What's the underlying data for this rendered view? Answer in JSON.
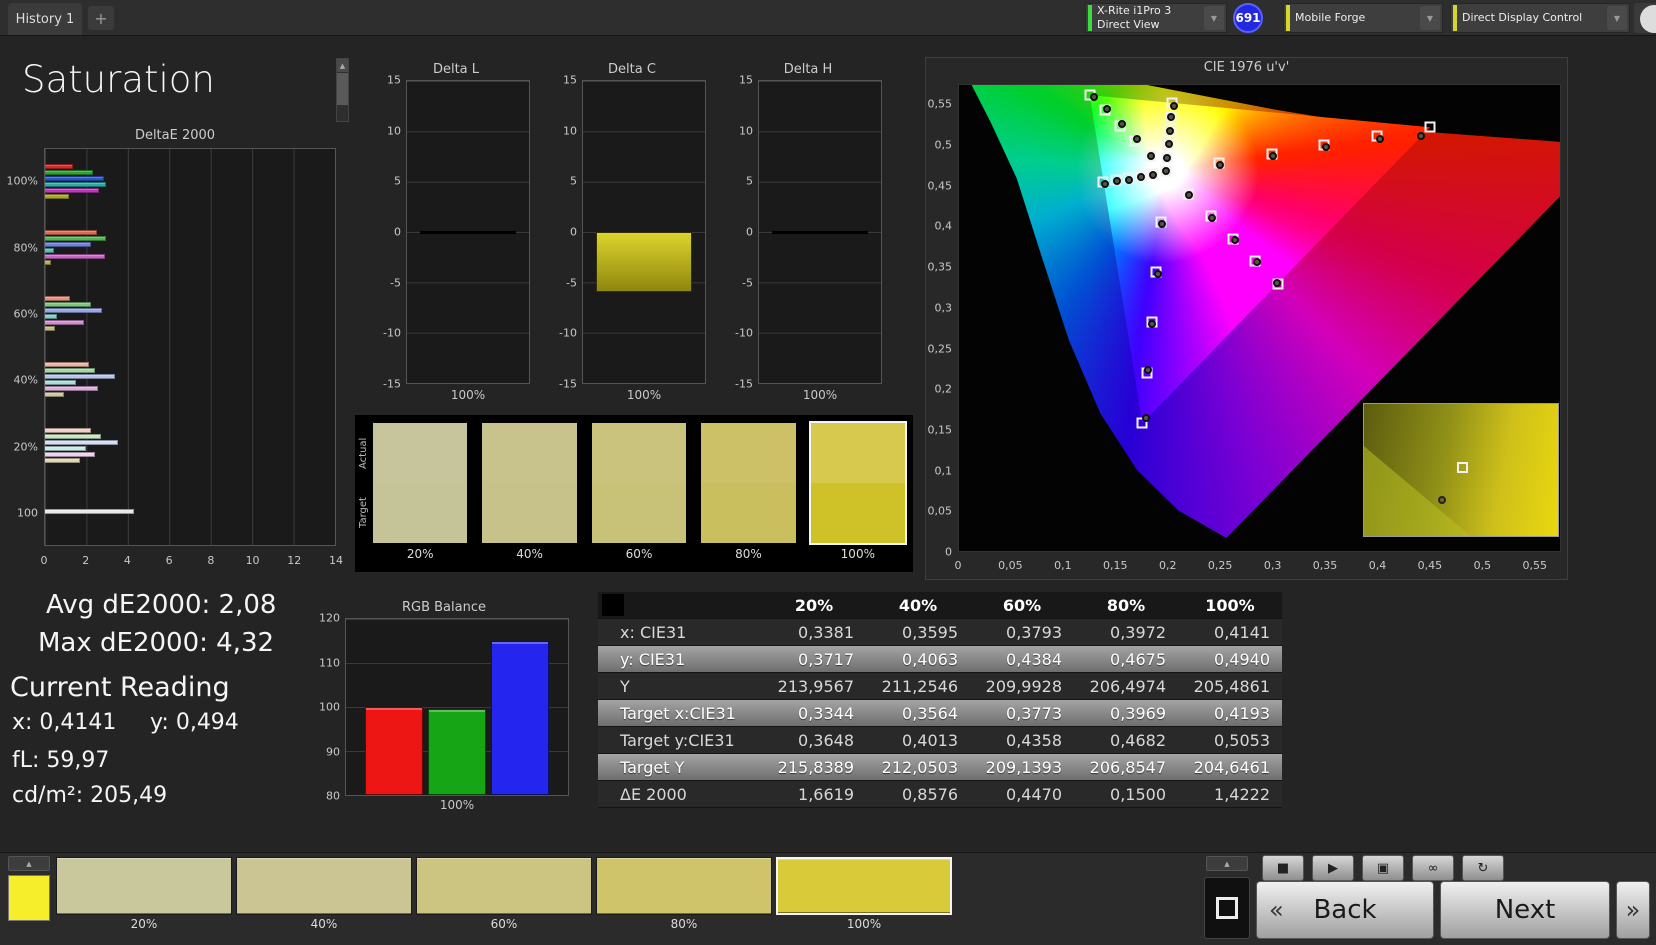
{
  "topbar": {
    "tab": "History 1",
    "add_tab": "+",
    "meter": {
      "line1": "X-Rite i1Pro 3",
      "line2": "Direct View",
      "accent": "#3ddc3d"
    },
    "badge": "691",
    "source": "Mobile Forge",
    "source_accent": "#d6d62a",
    "display_control": "Direct Display Control",
    "display_accent": "#d6d62a"
  },
  "page_title": "Saturation",
  "readings": {
    "avg": "Avg dE2000: 2,08",
    "max": "Max dE2000: 4,32",
    "heading": "Current Reading",
    "x": "x: 0,4141",
    "y": "y: 0,494",
    "fl": "fL: 59,97",
    "cd": "cd/m²: 205,49"
  },
  "strip": {
    "rows": [
      "Actual",
      "Target"
    ],
    "swatches": [
      {
        "label": "20%",
        "actual": "#c7c59c",
        "target": "#c5c398",
        "selected": false
      },
      {
        "label": "40%",
        "actual": "#c8c38d",
        "target": "#c6c289",
        "selected": false
      },
      {
        "label": "60%",
        "actual": "#cac37d",
        "target": "#c8c278",
        "selected": false
      },
      {
        "label": "80%",
        "actual": "#ccc167",
        "target": "#cabf5e",
        "selected": false
      },
      {
        "label": "100%",
        "actual": "#d7c94d",
        "target": "#cfc128",
        "selected": true
      }
    ]
  },
  "bottom": {
    "current_color": "#f6ee2b",
    "swatches": [
      {
        "label": "20%",
        "color": "#c9c79c",
        "selected": false
      },
      {
        "label": "40%",
        "color": "#cac592",
        "selected": false
      },
      {
        "label": "60%",
        "color": "#ccc481",
        "selected": false
      },
      {
        "label": "80%",
        "color": "#cfc46a",
        "selected": false
      },
      {
        "label": "100%",
        "color": "#d9ca3a",
        "selected": true
      }
    ],
    "transport": [
      {
        "name": "stop",
        "glyph": "■"
      },
      {
        "name": "play",
        "glyph": "▶"
      },
      {
        "name": "pattern-window",
        "glyph": "▣"
      },
      {
        "name": "loop",
        "glyph": "∞"
      },
      {
        "name": "continuous",
        "glyph": "↻"
      }
    ],
    "back_chevron": "«",
    "back": "Back",
    "next": "Next",
    "next_chevron": "»",
    "up_arrow": "▲"
  },
  "chart_data": {
    "deltae2000": {
      "type": "bar",
      "orientation": "horizontal",
      "title": "DeltaE 2000",
      "xlim": [
        0,
        14
      ],
      "xticks": [
        0,
        2,
        4,
        6,
        8,
        10,
        12,
        14
      ],
      "groups": [
        {
          "label": "100%",
          "bars": [
            {
              "color": "#d42a2a",
              "value": 1.35
            },
            {
              "color": "#2fa32f",
              "value": 2.3
            },
            {
              "color": "#2f55c8",
              "value": 2.85
            },
            {
              "color": "#2aada0",
              "value": 2.95
            },
            {
              "color": "#b93ab9",
              "value": 2.6
            },
            {
              "color": "#a8a62a",
              "value": 1.15
            }
          ]
        },
        {
          "label": "80%",
          "bars": [
            {
              "color": "#d96a58",
              "value": 2.5
            },
            {
              "color": "#57b257",
              "value": 2.95
            },
            {
              "color": "#6f80d6",
              "value": 2.2
            },
            {
              "color": "#58bdb2",
              "value": 0.45
            },
            {
              "color": "#c467c4",
              "value": 2.9
            },
            {
              "color": "#b3ad56",
              "value": 0.3
            }
          ]
        },
        {
          "label": "60%",
          "bars": [
            {
              "color": "#e29180",
              "value": 1.2
            },
            {
              "color": "#7fc47f",
              "value": 2.2
            },
            {
              "color": "#97a6e0",
              "value": 2.75
            },
            {
              "color": "#83ccc4",
              "value": 0.6
            },
            {
              "color": "#d08ed0",
              "value": 1.9
            },
            {
              "color": "#bfb983",
              "value": 0.5
            }
          ]
        },
        {
          "label": "40%",
          "bars": [
            {
              "color": "#eab4a6",
              "value": 2.1
            },
            {
              "color": "#a6d6a6",
              "value": 2.4
            },
            {
              "color": "#b9c4ea",
              "value": 3.4
            },
            {
              "color": "#a9dcd6",
              "value": 1.5
            },
            {
              "color": "#dcaede",
              "value": 2.55
            },
            {
              "color": "#ccc7a0",
              "value": 0.9
            }
          ]
        },
        {
          "label": "20%",
          "bars": [
            {
              "color": "#f2cfc6",
              "value": 2.2
            },
            {
              "color": "#c6e6c6",
              "value": 2.7
            },
            {
              "color": "#d4dbf4",
              "value": 3.5
            },
            {
              "color": "#c9ebe7",
              "value": 2.0
            },
            {
              "color": "#ecd2ec",
              "value": 2.4
            },
            {
              "color": "#dcd8ba",
              "value": 1.7
            }
          ]
        },
        {
          "label": "100",
          "bars": [
            {
              "color": "#e8e8e8",
              "value": 4.32
            }
          ]
        }
      ]
    },
    "delta_l": {
      "type": "bar",
      "title": "Delta L",
      "ylim": [
        -15,
        15
      ],
      "yticks": [
        15,
        10,
        5,
        0,
        -5,
        -10,
        -15
      ],
      "xlabel": "100%",
      "value": 0,
      "bar_top": "#000000",
      "bar_bottom": "#000000"
    },
    "delta_c": {
      "type": "bar",
      "title": "Delta C",
      "ylim": [
        -15,
        15
      ],
      "yticks": [
        15,
        10,
        5,
        0,
        -5,
        -10,
        -15
      ],
      "xlabel": "100%",
      "value": -6,
      "bar_top": "#dcd42c",
      "bar_bottom": "#8f870e"
    },
    "delta_h": {
      "type": "bar",
      "title": "Delta H",
      "ylim": [
        -15,
        15
      ],
      "yticks": [
        15,
        10,
        5,
        0,
        -5,
        -10,
        -15
      ],
      "xlabel": "100%",
      "value": 0,
      "bar_top": "#000000",
      "bar_bottom": "#000000"
    },
    "rgb_balance": {
      "type": "bar",
      "title": "RGB Balance",
      "ylim": [
        80,
        120
      ],
      "yticks": [
        120,
        110,
        100,
        90,
        80
      ],
      "xlabel": "100%",
      "series": [
        {
          "name": "Red",
          "value": 100,
          "color": "#ee1515"
        },
        {
          "name": "Green",
          "value": 99.5,
          "color": "#15a515"
        },
        {
          "name": "Blue",
          "value": 115,
          "color": "#2525f0"
        }
      ]
    },
    "cie": {
      "type": "scatter",
      "title": "CIE 1976 u'v'",
      "xlim": [
        0,
        0.575
      ],
      "ylim": [
        0,
        0.575
      ],
      "xtick_labels": [
        "0",
        "0,05",
        "0,1",
        "0,15",
        "0,2",
        "0,25",
        "0,3",
        "0,35",
        "0,4",
        "0,45",
        "0,5",
        "0,55"
      ],
      "ytick_labels": [
        "0,55",
        "0,5",
        "0,45",
        "0,4",
        "0,35",
        "0,3",
        "0,25",
        "0,2",
        "0,15",
        "0,1",
        "0,05",
        "0"
      ],
      "gamut_triangle": [
        [
          0.4507,
          0.5229
        ],
        [
          0.125,
          0.5625
        ],
        [
          0.1754,
          0.1579
        ]
      ],
      "white_point": [
        0.1978,
        0.4683
      ],
      "targets": [
        [
          0.1978,
          0.4683
        ],
        [
          0.2484,
          0.4792
        ],
        [
          0.299,
          0.4901
        ],
        [
          0.3495,
          0.5011
        ],
        [
          0.4001,
          0.512
        ],
        [
          0.4507,
          0.5229
        ],
        [
          0.1832,
          0.4871
        ],
        [
          0.1687,
          0.506
        ],
        [
          0.1541,
          0.5248
        ],
        [
          0.1396,
          0.5437
        ],
        [
          0.125,
          0.5625
        ],
        [
          0.1933,
          0.4062
        ],
        [
          0.1888,
          0.3441
        ],
        [
          0.1844,
          0.2821
        ],
        [
          0.1799,
          0.22
        ],
        [
          0.1754,
          0.1579
        ],
        [
          0.1858,
          0.4656
        ],
        [
          0.1739,
          0.463
        ],
        [
          0.1619,
          0.4603
        ],
        [
          0.15,
          0.4577
        ],
        [
          0.138,
          0.455
        ],
        [
          0.2192,
          0.4406
        ],
        [
          0.2407,
          0.413
        ],
        [
          0.2621,
          0.3853
        ],
        [
          0.2836,
          0.3577
        ],
        [
          0.305,
          0.33
        ],
        [
          0.199,
          0.4852
        ],
        [
          0.2003,
          0.5022
        ],
        [
          0.2015,
          0.5191
        ],
        [
          0.2028,
          0.5361
        ],
        [
          0.204,
          0.553
        ]
      ],
      "measured": [
        [
          0.1985,
          0.469
        ],
        [
          0.25,
          0.476
        ],
        [
          0.3,
          0.488
        ],
        [
          0.351,
          0.498
        ],
        [
          0.403,
          0.508
        ],
        [
          0.442,
          0.512
        ],
        [
          0.184,
          0.488
        ],
        [
          0.17,
          0.508
        ],
        [
          0.156,
          0.527
        ],
        [
          0.142,
          0.545
        ],
        [
          0.129,
          0.56
        ],
        [
          0.194,
          0.404
        ],
        [
          0.19,
          0.342
        ],
        [
          0.185,
          0.28
        ],
        [
          0.181,
          0.223
        ],
        [
          0.179,
          0.164
        ],
        [
          0.186,
          0.464
        ],
        [
          0.1745,
          0.461
        ],
        [
          0.163,
          0.458
        ],
        [
          0.151,
          0.456
        ],
        [
          0.14,
          0.453
        ],
        [
          0.22,
          0.439
        ],
        [
          0.242,
          0.411
        ],
        [
          0.264,
          0.384
        ],
        [
          0.285,
          0.356
        ],
        [
          0.304,
          0.331
        ],
        [
          0.1992,
          0.485
        ],
        [
          0.2006,
          0.5018
        ],
        [
          0.2018,
          0.5185
        ],
        [
          0.203,
          0.5355
        ],
        [
          0.206,
          0.549
        ]
      ]
    },
    "table": {
      "columns": [
        "20%",
        "40%",
        "60%",
        "80%",
        "100%"
      ],
      "rows": [
        {
          "label": "x: CIE31",
          "values": [
            "0,3381",
            "0,3595",
            "0,3793",
            "0,3972",
            "0,4141"
          ],
          "shaded": false
        },
        {
          "label": "y: CIE31",
          "values": [
            "0,3717",
            "0,4063",
            "0,4384",
            "0,4675",
            "0,4940"
          ],
          "shaded": true
        },
        {
          "label": "Y",
          "values": [
            "213,9567",
            "211,2546",
            "209,9928",
            "206,4974",
            "205,4861"
          ],
          "shaded": false
        },
        {
          "label": "Target x:CIE31",
          "values": [
            "0,3344",
            "0,3564",
            "0,3773",
            "0,3969",
            "0,4193"
          ],
          "shaded": true
        },
        {
          "label": "Target y:CIE31",
          "values": [
            "0,3648",
            "0,4013",
            "0,4358",
            "0,4682",
            "0,5053"
          ],
          "shaded": false
        },
        {
          "label": "Target Y",
          "values": [
            "215,8389",
            "212,0503",
            "209,1393",
            "206,8547",
            "204,6461"
          ],
          "shaded": true
        },
        {
          "label": "ΔE 2000",
          "values": [
            "1,6619",
            "0,8576",
            "0,4470",
            "0,1500",
            "1,4222"
          ],
          "shaded": false
        }
      ]
    }
  }
}
